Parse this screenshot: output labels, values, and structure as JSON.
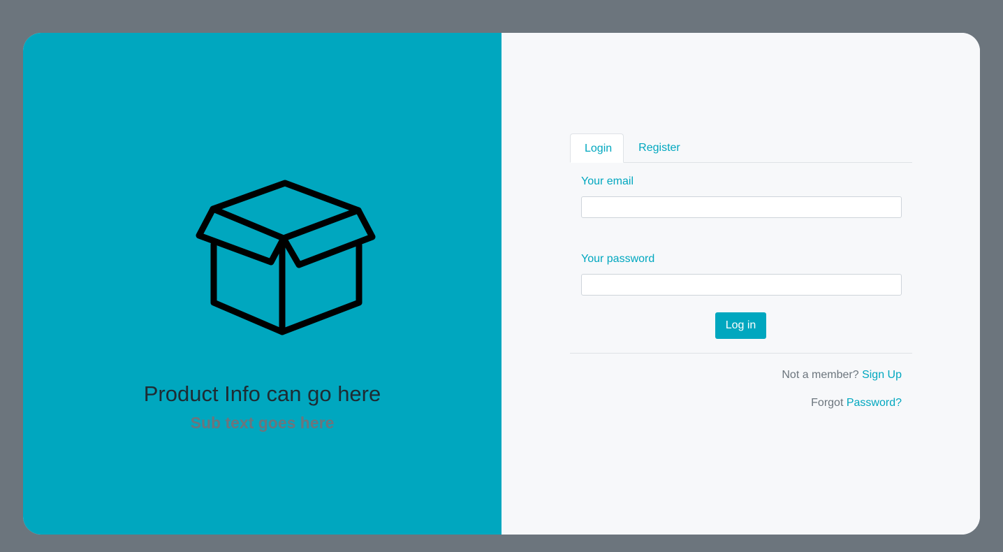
{
  "left_panel": {
    "title": "Product Info can go here",
    "subtitle": "Sub text goes here",
    "icon": "box-icon",
    "background": "#00a7bf"
  },
  "tabs": [
    {
      "label": "Login",
      "active": true
    },
    {
      "label": "Register",
      "active": false
    }
  ],
  "form": {
    "email_label": "Your email",
    "email_value": "",
    "password_label": "Your password",
    "password_value": "",
    "submit_label": "Log in"
  },
  "footer": {
    "not_member_text": "Not a member?",
    "sign_up_link": "Sign Up",
    "forgot_text": "Forgot",
    "password_link": "Password?"
  },
  "colors": {
    "accent": "#00a7bf",
    "muted_text": "#6c757d",
    "page_background": "#6c757d",
    "form_background": "#f7f8fa"
  }
}
